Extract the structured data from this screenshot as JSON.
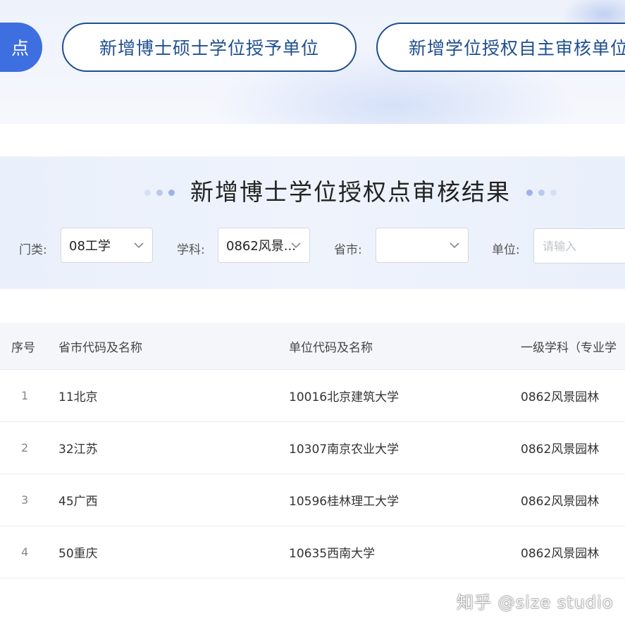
{
  "tabs": [
    {
      "label": "点",
      "active": true
    },
    {
      "label": "新增博士硕士学位授予单位",
      "active": false
    },
    {
      "label": "新增学位授权自主审核单位",
      "active": false
    }
  ],
  "section": {
    "title": "新增博士学位授权点审核结果"
  },
  "filters": {
    "category": {
      "label": "门类:",
      "value": "08工学"
    },
    "discipline": {
      "label": "学科:",
      "value": "0862风景..."
    },
    "province": {
      "label": "省市:",
      "value": ""
    },
    "unit": {
      "label": "单位:",
      "placeholder": "请输入"
    }
  },
  "table": {
    "headers": {
      "no": "序号",
      "province": "省市代码及名称",
      "unit": "单位代码及名称",
      "discipline": "一级学科（专业学"
    },
    "rows": [
      {
        "no": "1",
        "province": "11北京",
        "unit": "10016北京建筑大学",
        "discipline": "0862风景园林"
      },
      {
        "no": "2",
        "province": "32江苏",
        "unit": "10307南京农业大学",
        "discipline": "0862风景园林"
      },
      {
        "no": "3",
        "province": "45广西",
        "unit": "10596桂林理工大学",
        "discipline": "0862风景园林"
      },
      {
        "no": "4",
        "province": "50重庆",
        "unit": "10635西南大学",
        "discipline": "0862风景园林"
      }
    ]
  },
  "watermark": "知乎 @size studio",
  "colors": {
    "active_tab": "#3d6fe0",
    "tab_outline": "#1f4f8f",
    "panel_bg": "#eaf0fb"
  }
}
